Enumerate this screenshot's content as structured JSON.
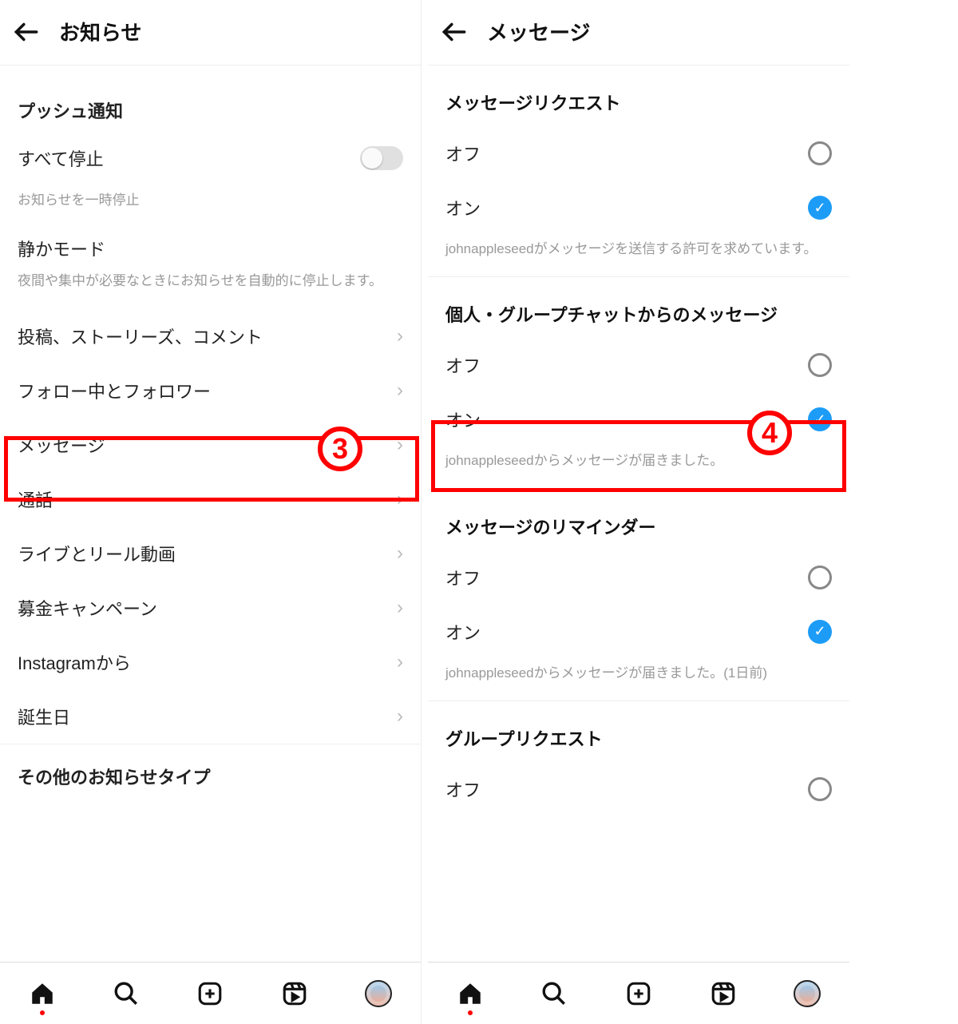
{
  "left": {
    "header_title": "お知らせ",
    "section_push": "プッシュ通知",
    "pause_all": "すべて停止",
    "pause_hint": "お知らせを一時停止",
    "quiet_mode": "静かモード",
    "quiet_hint": "夜間や集中が必要なときにお知らせを自動的に停止します。",
    "nav_items": [
      "投稿、ストーリーズ、コメント",
      "フォロー中とフォロワー",
      "メッセージ",
      "通話",
      "ライブとリール動画",
      "募金キャンペーン",
      "Instagramから",
      "誕生日"
    ],
    "other_section": "その他のお知らせタイプ"
  },
  "right": {
    "header_title": "メッセージ",
    "sec1_title": "メッセージリクエスト",
    "off": "オフ",
    "on": "オン",
    "sec1_hint": "johnappleseedがメッセージを送信する許可を求めています。",
    "sec2_title": "個人・グループチャットからのメッセージ",
    "sec2_hint": "johnappleseedからメッセージが届きました。",
    "sec3_title": "メッセージのリマインダー",
    "sec3_hint": "johnappleseedからメッセージが届きました。(1日前)",
    "sec4_title": "グループリクエスト"
  },
  "callouts": {
    "c3": "3",
    "c4": "4"
  }
}
